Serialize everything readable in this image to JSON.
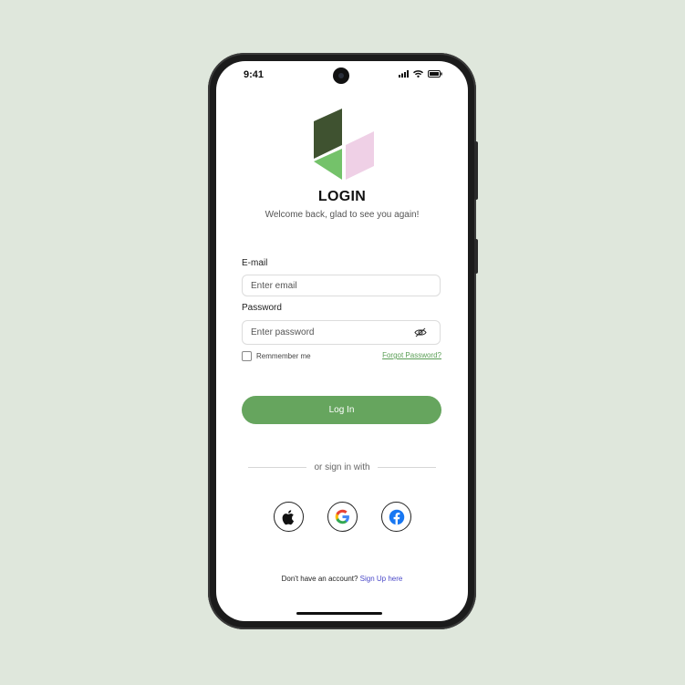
{
  "status_bar": {
    "time": "9:41"
  },
  "header": {
    "title": "LOGIN",
    "subtitle": "Welcome back, glad to see you again!"
  },
  "form": {
    "email_label": "E-mail",
    "email_placeholder": "Enter email",
    "email_value": "",
    "password_label": "Password",
    "password_placeholder": "Enter password",
    "password_value": "",
    "remember_label": "Remmember me",
    "remember_checked": false,
    "forgot_label": "Forgot Password?",
    "login_label": "Log In"
  },
  "divider_text": "or sign in with",
  "social": [
    {
      "name": "apple",
      "icon": "apple-icon"
    },
    {
      "name": "google",
      "icon": "google-icon"
    },
    {
      "name": "facebook",
      "icon": "facebook-icon"
    }
  ],
  "footer": {
    "prompt": "Don't have an account? ",
    "link": "Sign Up here"
  },
  "colors": {
    "background": "#dfe7dc",
    "accent": "#66a55e",
    "link": "#4a48c8",
    "logo_dark": "#3f5230",
    "logo_green": "#74c26a",
    "logo_pink": "#efd0e6"
  }
}
